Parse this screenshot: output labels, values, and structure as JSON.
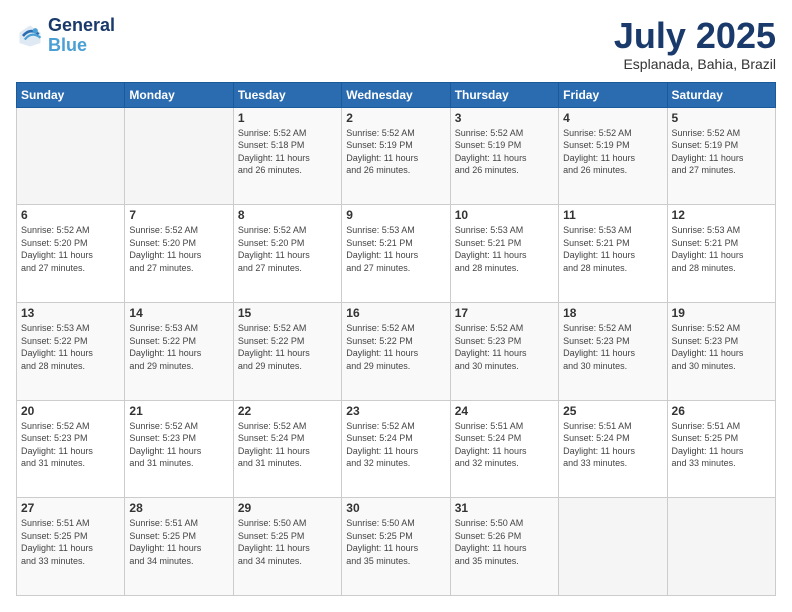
{
  "logo": {
    "line1": "General",
    "line2": "Blue"
  },
  "title": "July 2025",
  "subtitle": "Esplanada, Bahia, Brazil",
  "weekdays": [
    "Sunday",
    "Monday",
    "Tuesday",
    "Wednesday",
    "Thursday",
    "Friday",
    "Saturday"
  ],
  "weeks": [
    [
      {
        "day": "",
        "info": ""
      },
      {
        "day": "",
        "info": ""
      },
      {
        "day": "1",
        "info": "Sunrise: 5:52 AM\nSunset: 5:18 PM\nDaylight: 11 hours\nand 26 minutes."
      },
      {
        "day": "2",
        "info": "Sunrise: 5:52 AM\nSunset: 5:19 PM\nDaylight: 11 hours\nand 26 minutes."
      },
      {
        "day": "3",
        "info": "Sunrise: 5:52 AM\nSunset: 5:19 PM\nDaylight: 11 hours\nand 26 minutes."
      },
      {
        "day": "4",
        "info": "Sunrise: 5:52 AM\nSunset: 5:19 PM\nDaylight: 11 hours\nand 26 minutes."
      },
      {
        "day": "5",
        "info": "Sunrise: 5:52 AM\nSunset: 5:19 PM\nDaylight: 11 hours\nand 27 minutes."
      }
    ],
    [
      {
        "day": "6",
        "info": "Sunrise: 5:52 AM\nSunset: 5:20 PM\nDaylight: 11 hours\nand 27 minutes."
      },
      {
        "day": "7",
        "info": "Sunrise: 5:52 AM\nSunset: 5:20 PM\nDaylight: 11 hours\nand 27 minutes."
      },
      {
        "day": "8",
        "info": "Sunrise: 5:52 AM\nSunset: 5:20 PM\nDaylight: 11 hours\nand 27 minutes."
      },
      {
        "day": "9",
        "info": "Sunrise: 5:53 AM\nSunset: 5:21 PM\nDaylight: 11 hours\nand 27 minutes."
      },
      {
        "day": "10",
        "info": "Sunrise: 5:53 AM\nSunset: 5:21 PM\nDaylight: 11 hours\nand 28 minutes."
      },
      {
        "day": "11",
        "info": "Sunrise: 5:53 AM\nSunset: 5:21 PM\nDaylight: 11 hours\nand 28 minutes."
      },
      {
        "day": "12",
        "info": "Sunrise: 5:53 AM\nSunset: 5:21 PM\nDaylight: 11 hours\nand 28 minutes."
      }
    ],
    [
      {
        "day": "13",
        "info": "Sunrise: 5:53 AM\nSunset: 5:22 PM\nDaylight: 11 hours\nand 28 minutes."
      },
      {
        "day": "14",
        "info": "Sunrise: 5:53 AM\nSunset: 5:22 PM\nDaylight: 11 hours\nand 29 minutes."
      },
      {
        "day": "15",
        "info": "Sunrise: 5:52 AM\nSunset: 5:22 PM\nDaylight: 11 hours\nand 29 minutes."
      },
      {
        "day": "16",
        "info": "Sunrise: 5:52 AM\nSunset: 5:22 PM\nDaylight: 11 hours\nand 29 minutes."
      },
      {
        "day": "17",
        "info": "Sunrise: 5:52 AM\nSunset: 5:23 PM\nDaylight: 11 hours\nand 30 minutes."
      },
      {
        "day": "18",
        "info": "Sunrise: 5:52 AM\nSunset: 5:23 PM\nDaylight: 11 hours\nand 30 minutes."
      },
      {
        "day": "19",
        "info": "Sunrise: 5:52 AM\nSunset: 5:23 PM\nDaylight: 11 hours\nand 30 minutes."
      }
    ],
    [
      {
        "day": "20",
        "info": "Sunrise: 5:52 AM\nSunset: 5:23 PM\nDaylight: 11 hours\nand 31 minutes."
      },
      {
        "day": "21",
        "info": "Sunrise: 5:52 AM\nSunset: 5:23 PM\nDaylight: 11 hours\nand 31 minutes."
      },
      {
        "day": "22",
        "info": "Sunrise: 5:52 AM\nSunset: 5:24 PM\nDaylight: 11 hours\nand 31 minutes."
      },
      {
        "day": "23",
        "info": "Sunrise: 5:52 AM\nSunset: 5:24 PM\nDaylight: 11 hours\nand 32 minutes."
      },
      {
        "day": "24",
        "info": "Sunrise: 5:51 AM\nSunset: 5:24 PM\nDaylight: 11 hours\nand 32 minutes."
      },
      {
        "day": "25",
        "info": "Sunrise: 5:51 AM\nSunset: 5:24 PM\nDaylight: 11 hours\nand 33 minutes."
      },
      {
        "day": "26",
        "info": "Sunrise: 5:51 AM\nSunset: 5:25 PM\nDaylight: 11 hours\nand 33 minutes."
      }
    ],
    [
      {
        "day": "27",
        "info": "Sunrise: 5:51 AM\nSunset: 5:25 PM\nDaylight: 11 hours\nand 33 minutes."
      },
      {
        "day": "28",
        "info": "Sunrise: 5:51 AM\nSunset: 5:25 PM\nDaylight: 11 hours\nand 34 minutes."
      },
      {
        "day": "29",
        "info": "Sunrise: 5:50 AM\nSunset: 5:25 PM\nDaylight: 11 hours\nand 34 minutes."
      },
      {
        "day": "30",
        "info": "Sunrise: 5:50 AM\nSunset: 5:25 PM\nDaylight: 11 hours\nand 35 minutes."
      },
      {
        "day": "31",
        "info": "Sunrise: 5:50 AM\nSunset: 5:26 PM\nDaylight: 11 hours\nand 35 minutes."
      },
      {
        "day": "",
        "info": ""
      },
      {
        "day": "",
        "info": ""
      }
    ]
  ]
}
